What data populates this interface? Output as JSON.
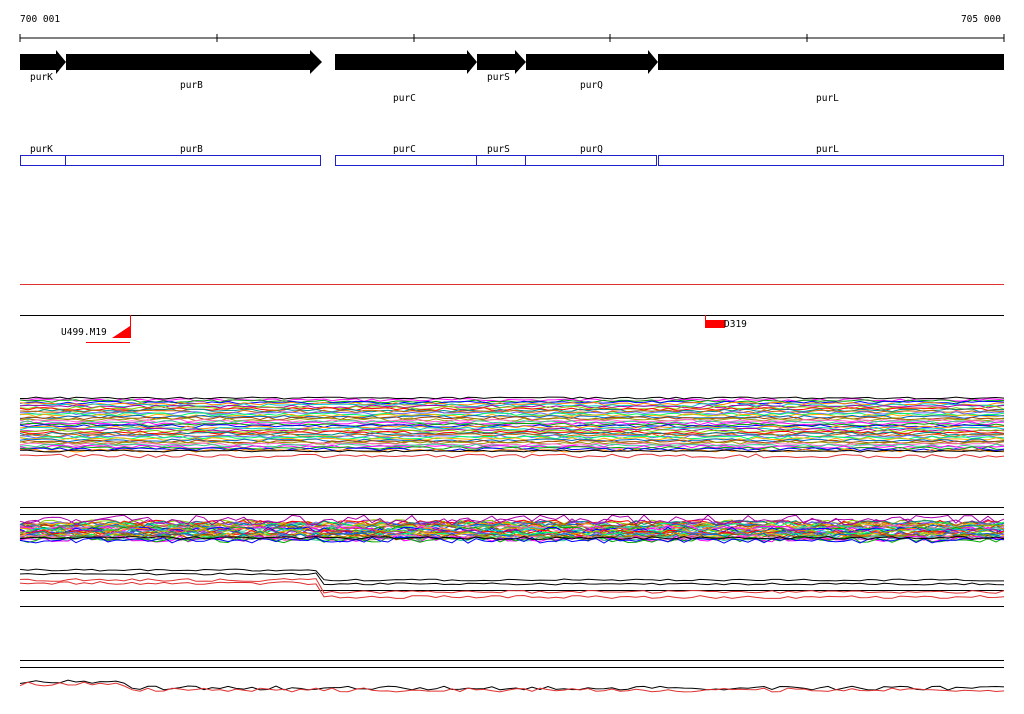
{
  "ruler": {
    "start_label": "700 001",
    "end_label": "705 000"
  },
  "genes": [
    {
      "name": "purK",
      "strand": "+"
    },
    {
      "name": "purB",
      "strand": "+"
    },
    {
      "name": "purC",
      "strand": "+"
    },
    {
      "name": "purS",
      "strand": "+"
    },
    {
      "name": "purQ",
      "strand": "+"
    },
    {
      "name": "purL",
      "strand": "+"
    }
  ],
  "operon_boxes": [
    "purK",
    "purB",
    "purC",
    "purS",
    "purQ",
    "purL"
  ],
  "features": [
    {
      "name": "U499.M19"
    },
    {
      "name": "D319"
    }
  ],
  "colors": {
    "gene_arrow": "#000000",
    "operon_box": "#2020cc",
    "feature": "#ff0000",
    "track_line": "#000000",
    "separator": "#e03030"
  },
  "expression_palette": [
    "#ff00ff",
    "#00aa00",
    "#0000ff",
    "#ff8800",
    "#00cccc",
    "#aa00aa",
    "#88cc00",
    "#ff0000",
    "#008888",
    "#cc6600",
    "#6666ff",
    "#00ff66",
    "#ffaa00",
    "#0066cc",
    "#aa4400",
    "#999900",
    "#ff66cc",
    "#33cc99"
  ]
}
